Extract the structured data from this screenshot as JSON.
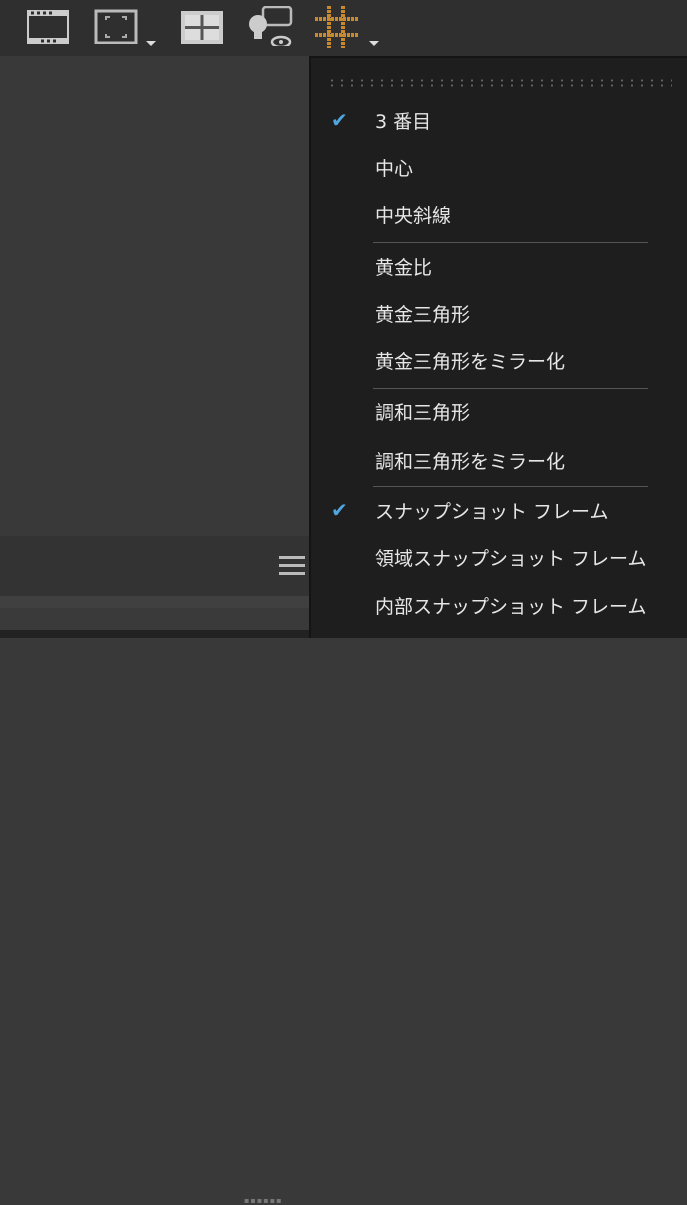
{
  "toolbar": {
    "icons": [
      "filmstrip-icon",
      "frame-icon",
      "grid-icon",
      "lightbulb-comment-icon",
      "overlay-grid-icon"
    ]
  },
  "menu": {
    "items": [
      {
        "label": "3 番目",
        "checked": true
      },
      {
        "label": "中心",
        "checked": false
      },
      {
        "label": "中央斜線",
        "checked": false
      },
      {
        "label": "黄金比",
        "checked": false
      },
      {
        "label": "黄金三角形",
        "checked": false
      },
      {
        "label": "黄金三角形をミラー化",
        "checked": false
      },
      {
        "label": "調和三角形",
        "checked": false
      },
      {
        "label": "調和三角形をミラー化",
        "checked": false
      },
      {
        "label": "スナップショット フレーム",
        "checked": true
      },
      {
        "label": "領域スナップショット フレーム",
        "checked": false
      },
      {
        "label": "内部スナップショット フレーム",
        "checked": false
      }
    ],
    "check_glyph": "✔"
  },
  "colors": {
    "accent": "#4ea6e0",
    "overlay": "#c8892f"
  }
}
